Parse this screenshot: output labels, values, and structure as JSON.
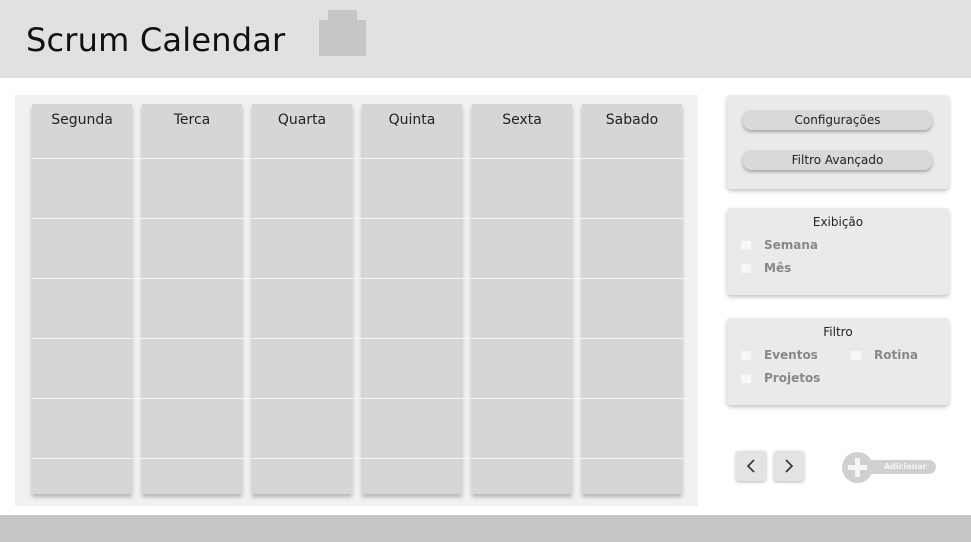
{
  "header": {
    "title": "Scrum Calendar",
    "logo_icon": "logo-placeholder-icon"
  },
  "calendar": {
    "days": [
      "Segunda",
      "Terca",
      "Quarta",
      "Quinta",
      "Sexta",
      "Sabado"
    ]
  },
  "actions": {
    "settings_label": "Configurações",
    "advanced_filter_label": "Filtro Avançado"
  },
  "display": {
    "title": "Exibição",
    "options": [
      "Semana",
      "Mês"
    ]
  },
  "filter": {
    "title": "Filtro",
    "options": [
      "Eventos",
      "Rotina",
      "Projetos"
    ]
  },
  "navigation": {
    "prev_icon": "chevron-left-icon",
    "next_icon": "chevron-right-icon"
  },
  "add": {
    "label": "Adicionar",
    "icon": "plus-icon"
  },
  "colors": {
    "header_bg": "#e1e1e1",
    "footer_bg": "#c7c7c7",
    "column_bg": "#d6d6d6",
    "panel_bg": "#eaeaea"
  }
}
